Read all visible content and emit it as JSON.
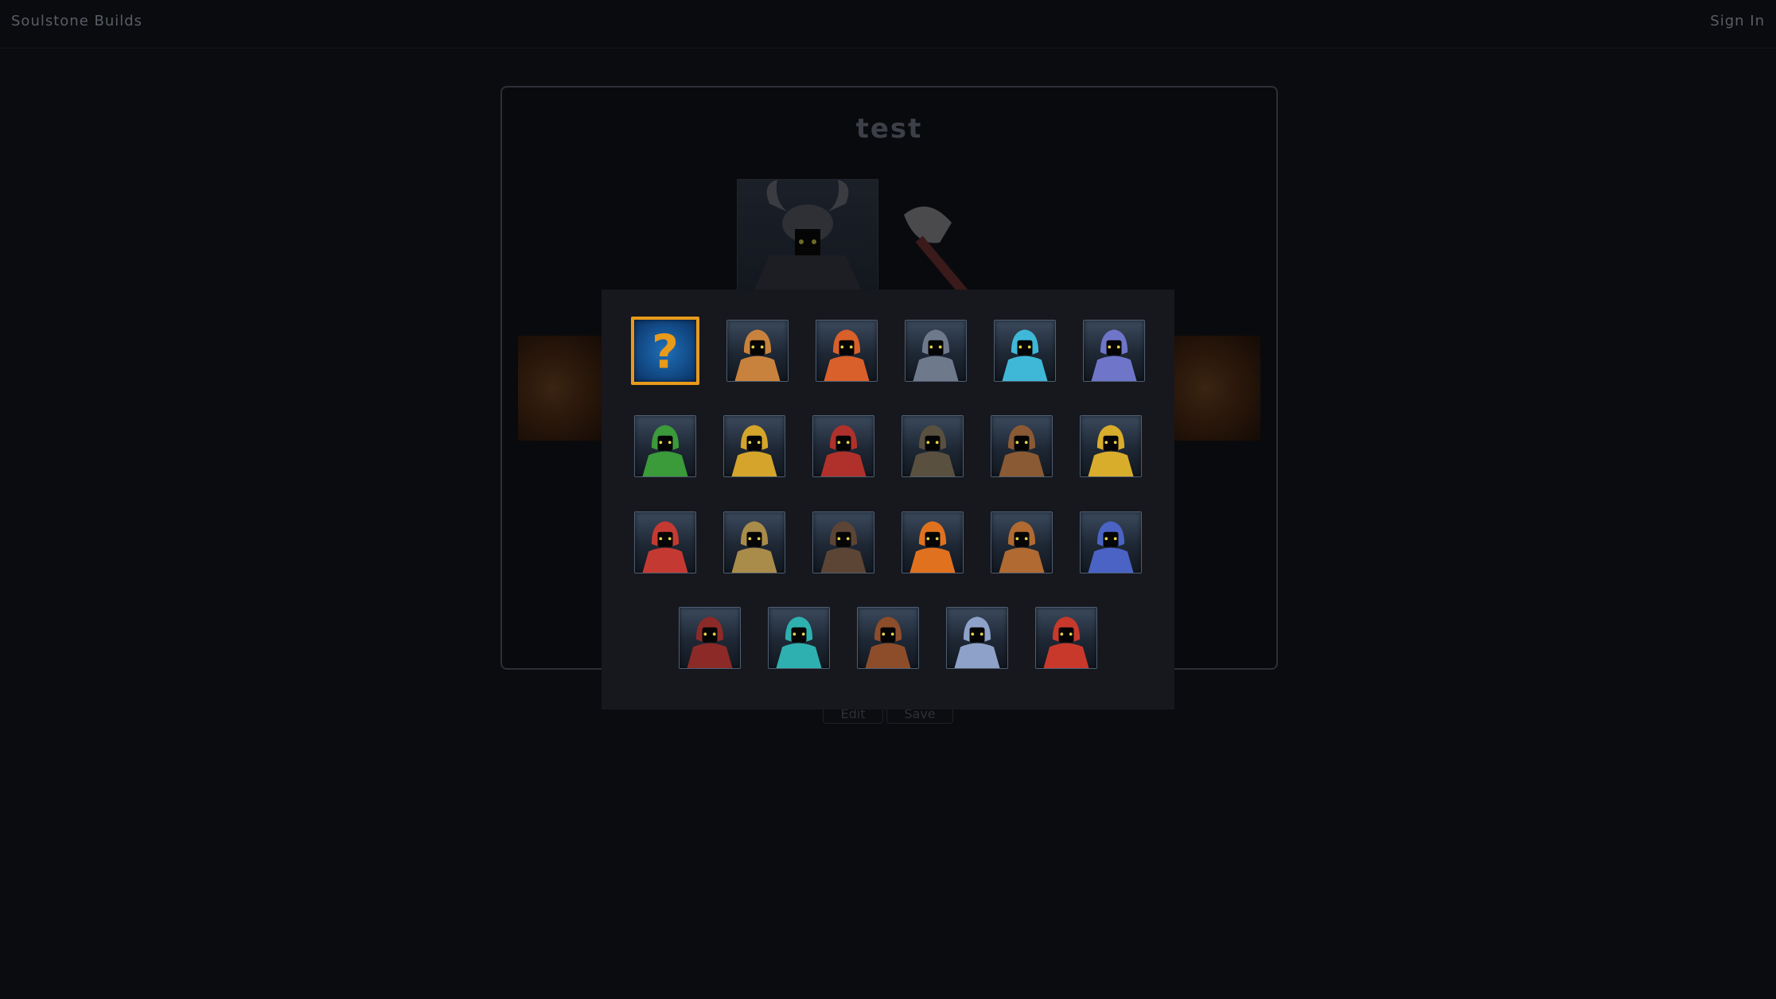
{
  "header": {
    "brand": "Soulstone Builds",
    "sign_in": "Sign In"
  },
  "build": {
    "title": "test",
    "buttons": [
      "Edit",
      "Save"
    ]
  },
  "hero_select": {
    "rows": [
      [
        {
          "name": "random-hero",
          "selected": true,
          "color": "#e89a1a"
        },
        {
          "name": "horned-viking-hero",
          "color": "#c9823d"
        },
        {
          "name": "orange-hood-hero",
          "color": "#d9602a"
        },
        {
          "name": "steel-knight-hero",
          "color": "#6e7a8c"
        },
        {
          "name": "cyan-crest-hero",
          "color": "#3fb8d8"
        },
        {
          "name": "arcane-mage-hero",
          "color": "#6f76c9"
        }
      ],
      [
        {
          "name": "green-archer-hero",
          "color": "#3b9a3a"
        },
        {
          "name": "golden-paladin-hero",
          "color": "#d4a52a"
        },
        {
          "name": "red-demon-hero",
          "color": "#b0312b"
        },
        {
          "name": "dark-rogue-hero",
          "color": "#5a5040"
        },
        {
          "name": "bronze-warrior-hero",
          "color": "#8a5a35"
        },
        {
          "name": "golden-crown-hero",
          "color": "#d9ad2c"
        }
      ],
      [
        {
          "name": "spartan-hero",
          "color": "#c43a32"
        },
        {
          "name": "horned-knight-hero",
          "color": "#a98c4a"
        },
        {
          "name": "minotaur-hero",
          "color": "#5c4535"
        },
        {
          "name": "fire-monk-hero",
          "color": "#e0721f"
        },
        {
          "name": "shaman-hero",
          "color": "#b06a32"
        },
        {
          "name": "royal-guard-hero",
          "color": "#4a63c4"
        }
      ],
      [
        {
          "name": "crimson-reaper-hero",
          "color": "#8c2a28"
        },
        {
          "name": "frost-lich-hero",
          "color": "#2fb0b0"
        },
        {
          "name": "bearded-dwarf-hero",
          "color": "#8d4d2b"
        },
        {
          "name": "frost-troll-hero",
          "color": "#8ea2c9"
        },
        {
          "name": "samurai-hero",
          "color": "#c8392c"
        }
      ]
    ]
  }
}
